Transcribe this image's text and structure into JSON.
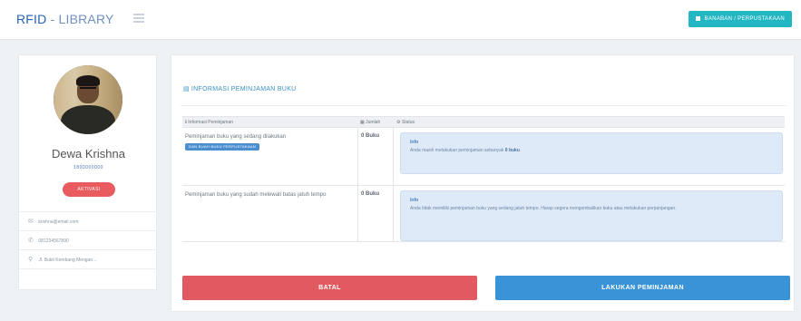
{
  "app": {
    "brand_main": "RFID",
    "brand_sub": " - LIBRARY",
    "user_button_label": "BANABAN / PERPUSTAKAAN"
  },
  "profile": {
    "name": "Dewa Krishna",
    "member_id": "1800000000",
    "status_badge": "AKTIVASI",
    "info": [
      {
        "icon": "email-icon",
        "glyph": "✉",
        "text": "krishna@email.com"
      },
      {
        "icon": "phone-icon",
        "glyph": "✆",
        "text": "081234567890"
      },
      {
        "icon": "location-icon",
        "glyph": "⚲",
        "text": "Jl. Bukit Kembang Mengan..."
      }
    ]
  },
  "panel": {
    "title": "INFORMASI PEMINJAMAN BUKU",
    "headers": {
      "info": "Informasi Peminjaman",
      "qty": "Jumlah",
      "status": "Status"
    },
    "rows": [
      {
        "desc": "Peminjaman buku yang sedang dilakukan",
        "tag": "DAN BUAH BUKU PERPUSTAKAAN",
        "qty": "0 Buku",
        "alert_title": "Info",
        "alert_text": "Anda masih melakukan peminjaman sebanyak ",
        "alert_bold": "0 buku"
      },
      {
        "desc": "Peminjaman buku yang sudah melewati batas jatuh tempo",
        "qty": "0 Buku",
        "alert_title": "Info",
        "alert_text": "Anda tidak memiliki peminjaman buku yang sedang jatuh tempo. Harap segera mengembalikan buku atau melakukan perpanjangan."
      }
    ],
    "cancel_label": "BATAL",
    "borrow_label": "LAKUKAN PEMINJAMAN"
  }
}
